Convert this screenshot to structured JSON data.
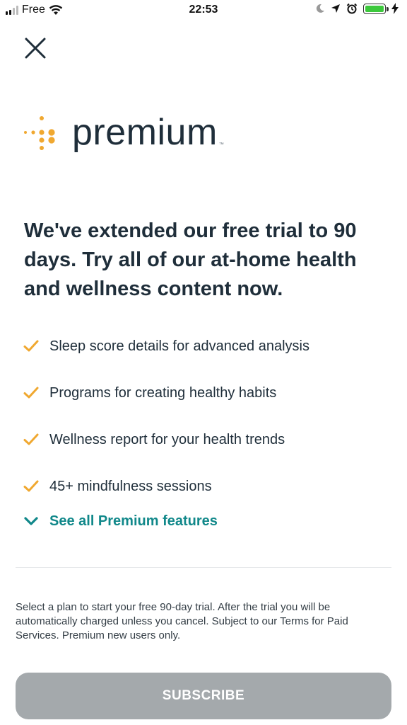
{
  "status_bar": {
    "carrier": "Free",
    "time": "22:53",
    "battery_color": "#3cc83c"
  },
  "header": {
    "close_icon": "close-icon"
  },
  "logo": {
    "wordmark": "premium",
    "trademark": "™",
    "brand_color": "#f0a830"
  },
  "headline": "We've extended our free trial to 90 days. Try all of our at-home health and wellness content now.",
  "features": [
    {
      "label": "Sleep score details for advanced analysis"
    },
    {
      "label": "Programs for creating healthy habits"
    },
    {
      "label": "Wellness report for your health trends"
    },
    {
      "label": "45+ mindfulness sessions"
    }
  ],
  "see_all": {
    "label": "See all Premium features",
    "color": "#11888a"
  },
  "terms": "Select a plan to start your free 90-day trial. After the trial you will be automatically charged unless you cancel. Subject to our Terms for Paid Services. Premium new users only.",
  "subscribe": {
    "label": "SUBSCRIBE",
    "color": "#a4a9ac"
  },
  "colors": {
    "check": "#f0a830",
    "text": "#1f2e3a"
  }
}
